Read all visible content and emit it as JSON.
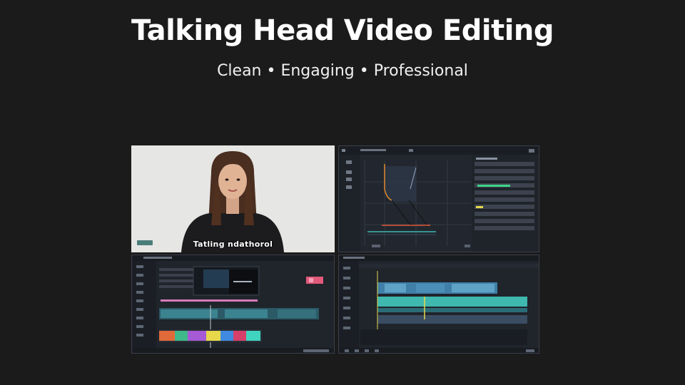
{
  "header": {
    "title": "Talking Head Video Editing",
    "subtitle": "Clean • Engaging • Professional"
  },
  "video_preview": {
    "caption": "Tatling ndathorol"
  },
  "colors": {
    "background": "#1b1b1c",
    "panel": "#22272f",
    "accent_teal": "#3fb8b0",
    "accent_orange": "#e38a2c",
    "accent_pink": "#d67ab7",
    "accent_yellow": "#e6d84a"
  }
}
